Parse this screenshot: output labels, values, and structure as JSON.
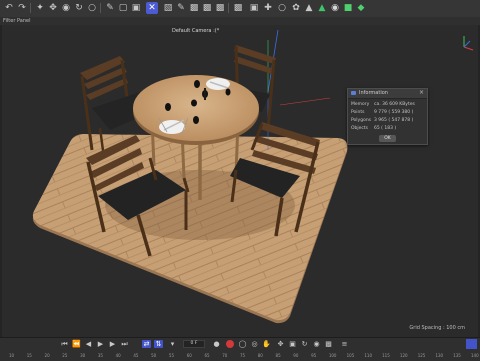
{
  "toolbar": {
    "icons": [
      "undo-icon",
      "redo-icon",
      "select-icon",
      "move-icon",
      "scale-icon",
      "rotate-icon",
      "object-icon",
      "brush-icon",
      "render-region-icon",
      "render-view-icon",
      "render-settings-icon",
      "cube-icon",
      "pen-icon",
      "subdivide-icon",
      "light-icon",
      "camera-icon",
      "snap-icon",
      "axis-icon",
      "floor-icon",
      "array-icon",
      "deformer-icon",
      "tag-icon",
      "environment-icon",
      "green-cube-icon",
      "effector-icon"
    ]
  },
  "menu": {
    "items": [
      "Filter",
      "Panel"
    ]
  },
  "viewport": {
    "camera_label": "Default Camera :(*",
    "grid_spacing": "Grid Spacing : 100 cm"
  },
  "info_panel": {
    "title": "Information",
    "rows": [
      {
        "label": "Memory",
        "value": "ca. 36 609 KBytes"
      },
      {
        "label": "Points",
        "value": "9 779 ( 559 380 )"
      },
      {
        "label": "Polygons",
        "value": "3 965 ( 547 878 )"
      },
      {
        "label": "Objects",
        "value": "65 ( 183 )"
      }
    ],
    "ok_label": "OK"
  },
  "timeline": {
    "frame_value": "0 F",
    "ruler_labels": [
      "10",
      "15",
      "20",
      "25",
      "30",
      "35",
      "40",
      "45",
      "50",
      "55",
      "60",
      "65",
      "70",
      "75",
      "80",
      "85",
      "90",
      "95",
      "100",
      "105",
      "110",
      "115",
      "120",
      "125",
      "130",
      "135",
      "140"
    ]
  },
  "colors": {
    "accent": "#4c5bd4",
    "record_red": "#d23a3a"
  }
}
